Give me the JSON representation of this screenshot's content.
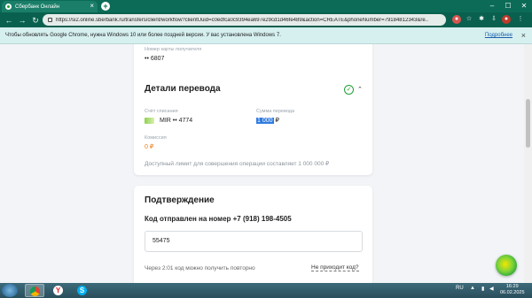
{
  "browser": {
    "tab_title": "Сбербанк Онлайн",
    "tab_close": "×",
    "new_tab": "+",
    "url": "https://si2.online.sberbank.ru/transfers/client/workflow?clientUuid=c0edfca0c9394ea697e29cd1d46fe489&action=CREATE&phoneNumber=79184812343&re...",
    "window_controls": [
      "–",
      "☐",
      "✕"
    ]
  },
  "infobar": {
    "message": "Чтобы обновлять Google Chrome, нужна Windows 10 или более поздней версии. У вас установлена Windows 7.",
    "link": "Подробнее",
    "close": "×"
  },
  "transfer": {
    "recipient_card_label": "Номер карты получателя",
    "recipient_card_value": "•• 6807",
    "details_title": "Детали перевода",
    "debit_account_label": "Счёт списания",
    "debit_account_value": "MIR •• 4774",
    "amount_label": "Сумма перевода",
    "amount_selected": "1 000",
    "amount_currency": "₽",
    "fee_label": "Комиссия",
    "fee_value": "0 ₽",
    "limit_text": "Доступный лимит для совершения операции составляет 1 000 000 ₽"
  },
  "confirmation": {
    "title": "Подтверждение",
    "code_sent": "Код отправлен на номер +7 (918) 198-4505",
    "code_value": "55475",
    "resend_text": "Через 2:01 код можно получить повторно",
    "no_code_link": "Не приходит код?"
  },
  "taskbar": {
    "lang": "RU",
    "time": "16:29",
    "date": "06.02.2025"
  },
  "colors": {
    "sber_green": "#21a038",
    "fee_orange": "#f07c15",
    "chrome_theme": "#0b6b57"
  }
}
